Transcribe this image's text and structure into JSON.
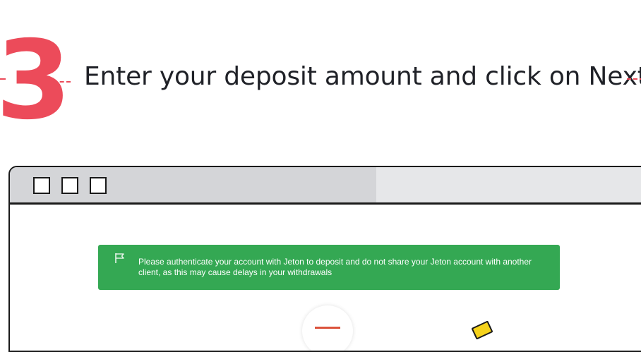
{
  "step": {
    "number": "3",
    "instruction": "Enter your deposit amount and click on Next."
  },
  "alert": {
    "icon": "flag-icon",
    "message": "Please authenticate your account with Jeton to deposit and do not share your Jeton account with another client, as this may cause delays in your withdrawals"
  },
  "colors": {
    "accent": "#ec4b5a",
    "alert_bg": "#34a853",
    "titlebar": "#d4d5d8"
  }
}
